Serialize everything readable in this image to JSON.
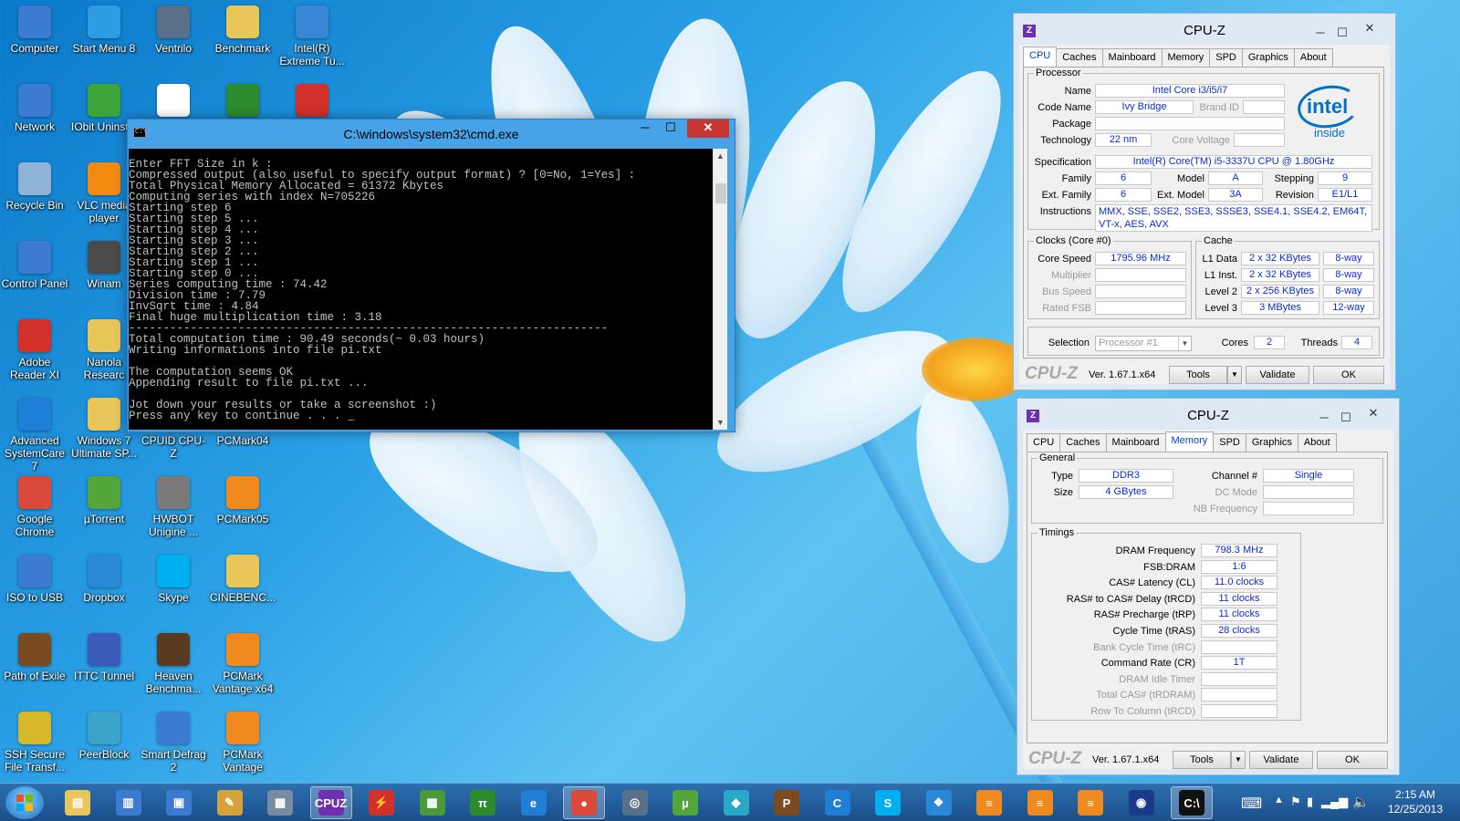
{
  "desktop_icons": [
    {
      "label": "Computer",
      "icon": "computer-icon",
      "color": "#3b7bd1"
    },
    {
      "label": "Start Menu 8",
      "icon": "start-menu-icon",
      "color": "#2f9be4"
    },
    {
      "label": "Ventrilo",
      "icon": "ventrilo-icon",
      "color": "#5a6f88"
    },
    {
      "label": "Benchmark",
      "icon": "folder-icon",
      "color": "#e8c65a"
    },
    {
      "label": "Intel(R) Extreme Tu...",
      "icon": "intel-xtu-icon",
      "color": "#3a86d6"
    },
    {
      "label": "Network",
      "icon": "network-icon",
      "color": "#3b7bd1"
    },
    {
      "label": "IObit Uninstal",
      "icon": "iobit-icon",
      "color": "#3da43a"
    },
    {
      "label": "",
      "icon": "blank-document-icon",
      "color": "#ffffff"
    },
    {
      "label": "",
      "icon": "superpi-icon",
      "color": "#2c8b2c"
    },
    {
      "label": "",
      "icon": "pdf-icon",
      "color": "#d2302b"
    },
    {
      "label": "Recycle Bin",
      "icon": "recycle-bin-icon",
      "color": "#8fb3d6"
    },
    {
      "label": "VLC media player",
      "icon": "vlc-icon",
      "color": "#f28a12"
    },
    {
      "label": "Control Panel",
      "icon": "control-panel-icon",
      "color": "#3b7bd1"
    },
    {
      "label": "Winam",
      "icon": "winamp-icon",
      "color": "#4a4a4a"
    },
    {
      "label": "Adobe Reader XI",
      "icon": "adobe-reader-icon",
      "color": "#d2302b"
    },
    {
      "label": "Nanola Researc",
      "icon": "folder-icon",
      "color": "#e8c65a"
    },
    {
      "label": "Advanced SystemCare 7",
      "icon": "advanced-systemcare-icon",
      "color": "#1f7fd6"
    },
    {
      "label": "Windows 7 Ultimate SP...",
      "icon": "folder-icon",
      "color": "#e8c65a"
    },
    {
      "label": "CPUID CPU-Z",
      "icon": "cpuz-icon",
      "color": "#6f2fb0"
    },
    {
      "label": "PCMark04",
      "icon": "pcmark-icon",
      "color": "#f08a1e"
    },
    {
      "label": "Google Chrome",
      "icon": "chrome-icon",
      "color": "#d94a3a"
    },
    {
      "label": "µTorrent",
      "icon": "utorrent-icon",
      "color": "#52a63a"
    },
    {
      "label": "HWBOT Unigine ...",
      "icon": "hwbot-icon",
      "color": "#7a7a7a"
    },
    {
      "label": "PCMark05",
      "icon": "pcmark-icon",
      "color": "#f08a1e"
    },
    {
      "label": "ISO to USB",
      "icon": "iso-usb-icon",
      "color": "#3b7bd1"
    },
    {
      "label": "Dropbox",
      "icon": "dropbox-icon",
      "color": "#2a88d8"
    },
    {
      "label": "Skype",
      "icon": "skype-icon",
      "color": "#00aff0"
    },
    {
      "label": "CINEBENC...",
      "icon": "folder-icon",
      "color": "#e8c65a"
    },
    {
      "label": "Path of Exile",
      "icon": "path-of-exile-icon",
      "color": "#7a4a20"
    },
    {
      "label": "ITTC Tunnel",
      "icon": "tunnel-icon",
      "color": "#3b5bb8"
    },
    {
      "label": "Heaven Benchma...",
      "icon": "heaven-icon",
      "color": "#5a3a20"
    },
    {
      "label": "PCMark Vantage x64",
      "icon": "pcmark-icon",
      "color": "#f08a1e"
    },
    {
      "label": "SSH Secure File Transf...",
      "icon": "ssh-icon",
      "color": "#d6b82a"
    },
    {
      "label": "PeerBlock",
      "icon": "peerblock-icon",
      "color": "#3aa3c9"
    },
    {
      "label": "Smart Defrag 2",
      "icon": "smart-defrag-icon",
      "color": "#3b7bd1"
    },
    {
      "label": "PCMark Vantage",
      "icon": "pcmark-icon",
      "color": "#f08a1e"
    }
  ],
  "cmd": {
    "title": "C:\\windows\\system32\\cmd.exe",
    "lines": [
      "Enter FFT Size in k :",
      "Compressed output (also useful to specify output format) ? [0=No, 1=Yes] :",
      "Total Physical Memory Allocated = 61372 Kbytes",
      "Computing series with index N=705226",
      "Starting step 6",
      "Starting step 5 ...",
      "Starting step 4 ...",
      "Starting step 3 ...",
      "Starting step 2 ...",
      "Starting step 1 ...",
      "Starting step 0 ...",
      "Series computing time : 74.42",
      "Division time : 7.79",
      "InvSqrt time : 4.84",
      "Final huge multiplication time : 3.18",
      "----------------------------------------------------------------------",
      "Total computation time : 90.49 seconds(~ 0.03 hours)",
      "Writing informations into file pi.txt",
      "",
      "The computation seems OK",
      "Appending result to file pi.txt ...",
      "",
      "Jot down your results or take a screenshot :)",
      "Press any key to continue . . . _"
    ]
  },
  "cpuz_cpu": {
    "title": "CPU-Z",
    "tabs": [
      "CPU",
      "Caches",
      "Mainboard",
      "Memory",
      "SPD",
      "Graphics",
      "About"
    ],
    "active_tab": "CPU",
    "processor_group": "Processor",
    "name_label": "Name",
    "name": "Intel Core i3/i5/i7",
    "codename_label": "Code Name",
    "codename": "Ivy Bridge",
    "brandid_label": "Brand ID",
    "brandid": "",
    "package_label": "Package",
    "package": "",
    "technology_label": "Technology",
    "technology": "22 nm",
    "voltage_label": "Core Voltage",
    "voltage": "",
    "spec_label": "Specification",
    "spec": "Intel(R) Core(TM) i5-3337U CPU @ 1.80GHz",
    "family_label": "Family",
    "family": "6",
    "model_label": "Model",
    "model": "A",
    "stepping_label": "Stepping",
    "stepping": "9",
    "extfamily_label": "Ext. Family",
    "extfamily": "6",
    "extmodel_label": "Ext. Model",
    "extmodel": "3A",
    "revision_label": "Revision",
    "revision": "E1/L1",
    "instructions_label": "Instructions",
    "instructions": "MMX, SSE, SSE2, SSE3, SSSE3, SSE4.1, SSE4.2, EM64T, VT-x, AES, AVX",
    "clocks_group": "Clocks (Core #0)",
    "corespeed_label": "Core Speed",
    "corespeed": "1795.96 MHz",
    "multiplier_label": "Multiplier",
    "multiplier": "",
    "busspeed_label": "Bus Speed",
    "busspeed": "",
    "ratedfsb_label": "Rated FSB",
    "ratedfsb": "",
    "cache_group": "Cache",
    "l1d_label": "L1 Data",
    "l1d": "2 x 32 KBytes",
    "l1d_way": "8-way",
    "l1i_label": "L1 Inst.",
    "l1i": "2 x 32 KBytes",
    "l1i_way": "8-way",
    "l2_label": "Level 2",
    "l2": "2 x 256 KBytes",
    "l2_way": "8-way",
    "l3_label": "Level 3",
    "l3": "3 MBytes",
    "l3_way": "12-way",
    "selection_label": "Selection",
    "selection": "Processor #1",
    "cores_label": "Cores",
    "cores": "2",
    "threads_label": "Threads",
    "threads": "4",
    "intel_word": "intel",
    "intel_inside": "inside",
    "brand": "CPU-Z",
    "version": "Ver. 1.67.1.x64",
    "tools": "Tools",
    "validate": "Validate",
    "ok": "OK"
  },
  "cpuz_mem": {
    "title": "CPU-Z",
    "tabs": [
      "CPU",
      "Caches",
      "Mainboard",
      "Memory",
      "SPD",
      "Graphics",
      "About"
    ],
    "active_tab": "Memory",
    "general_group": "General",
    "type_label": "Type",
    "type": "DDR3",
    "size_label": "Size",
    "size": "4 GBytes",
    "channel_label": "Channel #",
    "channel": "Single",
    "dcmode_label": "DC Mode",
    "dcmode": "",
    "nbfreq_label": "NB Frequency",
    "nbfreq": "",
    "timings_group": "Timings",
    "timings": [
      {
        "label": "DRAM Frequency",
        "value": "798.3 MHz",
        "dim": false
      },
      {
        "label": "FSB:DRAM",
        "value": "1:6",
        "dim": false
      },
      {
        "label": "CAS# Latency (CL)",
        "value": "11.0 clocks",
        "dim": false
      },
      {
        "label": "RAS# to CAS# Delay (tRCD)",
        "value": "11 clocks",
        "dim": false
      },
      {
        "label": "RAS# Precharge (tRP)",
        "value": "11 clocks",
        "dim": false
      },
      {
        "label": "Cycle Time (tRAS)",
        "value": "28 clocks",
        "dim": false
      },
      {
        "label": "Bank Cycle Time (tRC)",
        "value": "",
        "dim": true
      },
      {
        "label": "Command Rate (CR)",
        "value": "1T",
        "dim": false
      },
      {
        "label": "DRAM Idle Timer",
        "value": "",
        "dim": true
      },
      {
        "label": "Total CAS# (tRDRAM)",
        "value": "",
        "dim": true
      },
      {
        "label": "Row To Column (tRCD)",
        "value": "",
        "dim": true
      }
    ],
    "brand": "CPU-Z",
    "version": "Ver. 1.67.1.x64",
    "tools": "Tools",
    "validate": "Validate",
    "ok": "OK"
  },
  "taskbar": {
    "items": [
      {
        "icon": "file-explorer-icon",
        "glyph": "▤",
        "color": "#e8c65a",
        "active": false
      },
      {
        "icon": "task-manager-icon",
        "glyph": "▥",
        "color": "#3b7bd1",
        "active": false
      },
      {
        "icon": "remote-desktop-icon",
        "glyph": "▣",
        "color": "#3b7bd1",
        "active": false
      },
      {
        "icon": "paint-icon",
        "glyph": "✎",
        "color": "#d6a23a",
        "active": false
      },
      {
        "icon": "calculator-icon",
        "glyph": "▦",
        "color": "#7a8aa0",
        "active": false
      },
      {
        "icon": "cpuz-icon",
        "glyph": "CPUZ",
        "color": "#6f2fb0",
        "active": true
      },
      {
        "icon": "flash-icon",
        "glyph": "⚡",
        "color": "#d2302b",
        "active": false
      },
      {
        "icon": "gpu-tool-icon",
        "glyph": "▩",
        "color": "#4a9a3a",
        "active": false
      },
      {
        "icon": "superpi-icon",
        "glyph": "π",
        "color": "#2c8b2c",
        "active": false
      },
      {
        "icon": "internet-explorer-icon",
        "glyph": "e",
        "color": "#1f7fd6",
        "active": false
      },
      {
        "icon": "chrome-icon",
        "glyph": "●",
        "color": "#d94a3a",
        "active": true
      },
      {
        "icon": "ventrilo-icon",
        "glyph": "◎",
        "color": "#5a6f88",
        "active": false
      },
      {
        "icon": "utorrent-icon",
        "glyph": "µ",
        "color": "#52a63a",
        "active": false
      },
      {
        "icon": "3d-box-icon",
        "glyph": "◆",
        "color": "#2aa8c9",
        "active": false
      },
      {
        "icon": "path-of-exile-icon",
        "glyph": "P",
        "color": "#7a4a20",
        "active": false
      },
      {
        "icon": "advanced-systemcare-icon",
        "glyph": "C",
        "color": "#1f7fd6",
        "active": false
      },
      {
        "icon": "skype-icon",
        "glyph": "S",
        "color": "#00aff0",
        "active": false
      },
      {
        "icon": "dropbox-icon",
        "glyph": "❖",
        "color": "#2a88d8",
        "active": false
      },
      {
        "icon": "pcmark-icon",
        "glyph": "≡",
        "color": "#f08a1e",
        "active": false
      },
      {
        "icon": "pcmark-icon",
        "glyph": "≡",
        "color": "#f08a1e",
        "active": false
      },
      {
        "icon": "pcmark-icon",
        "glyph": "≡",
        "color": "#f08a1e",
        "active": false
      },
      {
        "icon": "globe-icon",
        "glyph": "◉",
        "color": "#1a3a8a",
        "active": false
      },
      {
        "icon": "cmd-icon",
        "glyph": "C:\\",
        "color": "#111111",
        "active": true
      }
    ],
    "time": "2:15 AM",
    "date": "12/25/2013"
  }
}
